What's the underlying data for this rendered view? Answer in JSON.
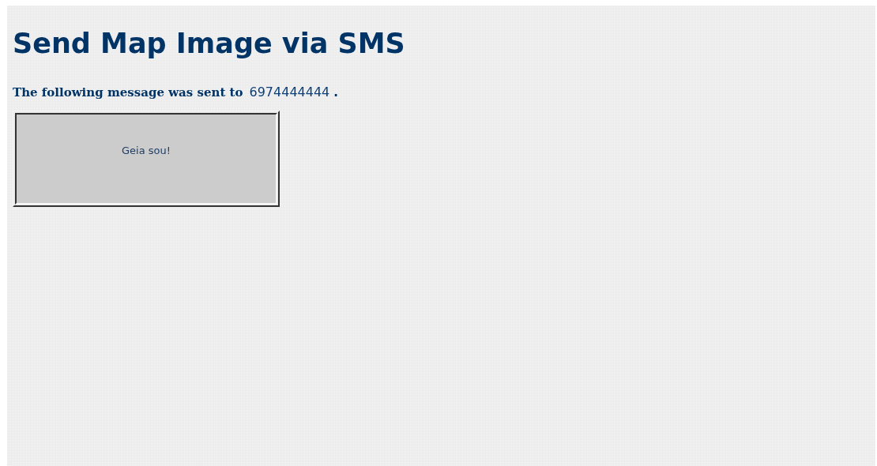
{
  "title": "Send Map Image via SMS",
  "confirmation": {
    "text": "The following message was sent to",
    "phone": "6974444444",
    "end": "."
  },
  "message": {
    "text": "Geia sou!"
  }
}
